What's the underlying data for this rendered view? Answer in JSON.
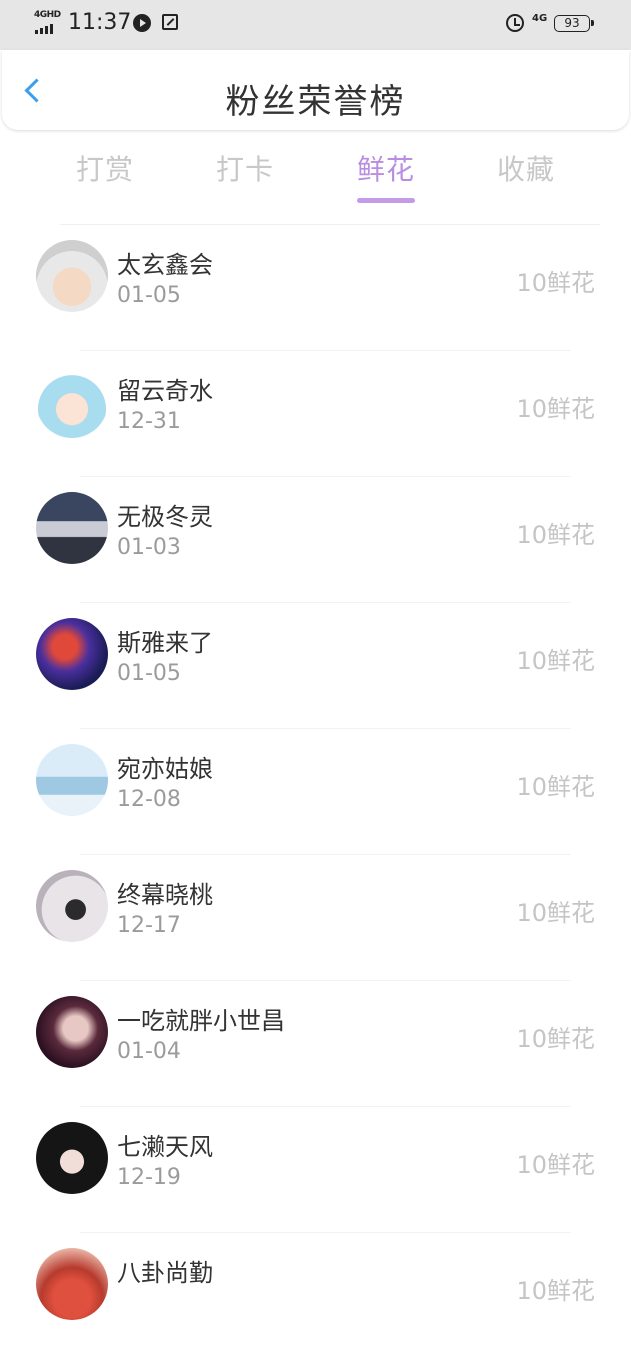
{
  "status_bar": {
    "network_tag": "4GHD",
    "time": "11:37",
    "net_4g": "4G",
    "battery": "93"
  },
  "header": {
    "title": "粉丝荣誉榜"
  },
  "tabs": [
    {
      "label": "打赏",
      "active": false
    },
    {
      "label": "打卡",
      "active": false
    },
    {
      "label": "鲜花",
      "active": true
    },
    {
      "label": "收藏",
      "active": false
    }
  ],
  "colors": {
    "accent_blue": "#3b9ff0",
    "active_tab": "#b88de2",
    "inactive_tab": "#c8c8c8"
  },
  "fans": [
    {
      "name": "太玄鑫会",
      "date": "01-05",
      "amount": "10鲜花"
    },
    {
      "name": "留云奇水",
      "date": "12-31",
      "amount": "10鲜花"
    },
    {
      "name": "无极冬灵",
      "date": "01-03",
      "amount": "10鲜花"
    },
    {
      "name": "斯雅来了",
      "date": "01-05",
      "amount": "10鲜花"
    },
    {
      "name": "宛亦姑娘",
      "date": "12-08",
      "amount": "10鲜花"
    },
    {
      "name": "终幕晓桃",
      "date": "12-17",
      "amount": "10鲜花"
    },
    {
      "name": "一吃就胖小世昌",
      "date": "01-04",
      "amount": "10鲜花"
    },
    {
      "name": "七濑天风",
      "date": "12-19",
      "amount": "10鲜花"
    },
    {
      "name": "八卦尚勤",
      "date": "",
      "amount": "10鲜花"
    }
  ]
}
